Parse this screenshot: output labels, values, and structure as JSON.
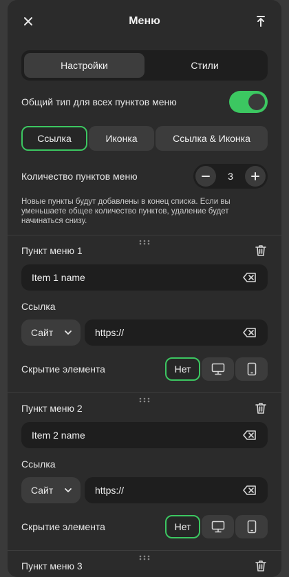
{
  "header": {
    "title": "Меню",
    "close_icon": "close-icon",
    "export_icon": "export-icon"
  },
  "tabs": [
    {
      "label": "Настройки",
      "active": true
    },
    {
      "label": "Стили",
      "active": false
    }
  ],
  "general_type": {
    "label": "Общий тип для всех пунктов меню",
    "enabled": true
  },
  "type_options": [
    {
      "label": "Ссылка",
      "selected": true
    },
    {
      "label": "Иконка",
      "selected": false
    },
    {
      "label": "Ссылка & Иконка",
      "selected": false
    }
  ],
  "count": {
    "label": "Количество пунктов меню",
    "value": "3",
    "minus_icon": "minus-icon",
    "plus_icon": "plus-icon"
  },
  "hint": "Новые пункты будут добавлены в конец списка. Если вы уменьшаете общее количество пунктов, удаление будет начинаться снизу.",
  "items": [
    {
      "title": "Пункт меню 1",
      "name_value": "Item 1 name",
      "link_label": "Ссылка",
      "link_type": "Сайт",
      "link_value": "https://",
      "hide_label": "Скрытие элемента",
      "hide_none": "Нет"
    },
    {
      "title": "Пункт меню 2",
      "name_value": "Item 2 name",
      "link_label": "Ссылка",
      "link_type": "Сайт",
      "link_value": "https://",
      "hide_label": "Скрытие элемента",
      "hide_none": "Нет"
    },
    {
      "title": "Пункт меню 3"
    }
  ],
  "colors": {
    "accent": "#3cc761",
    "panel": "#2b2b2b",
    "field": "#1e1e1e"
  }
}
